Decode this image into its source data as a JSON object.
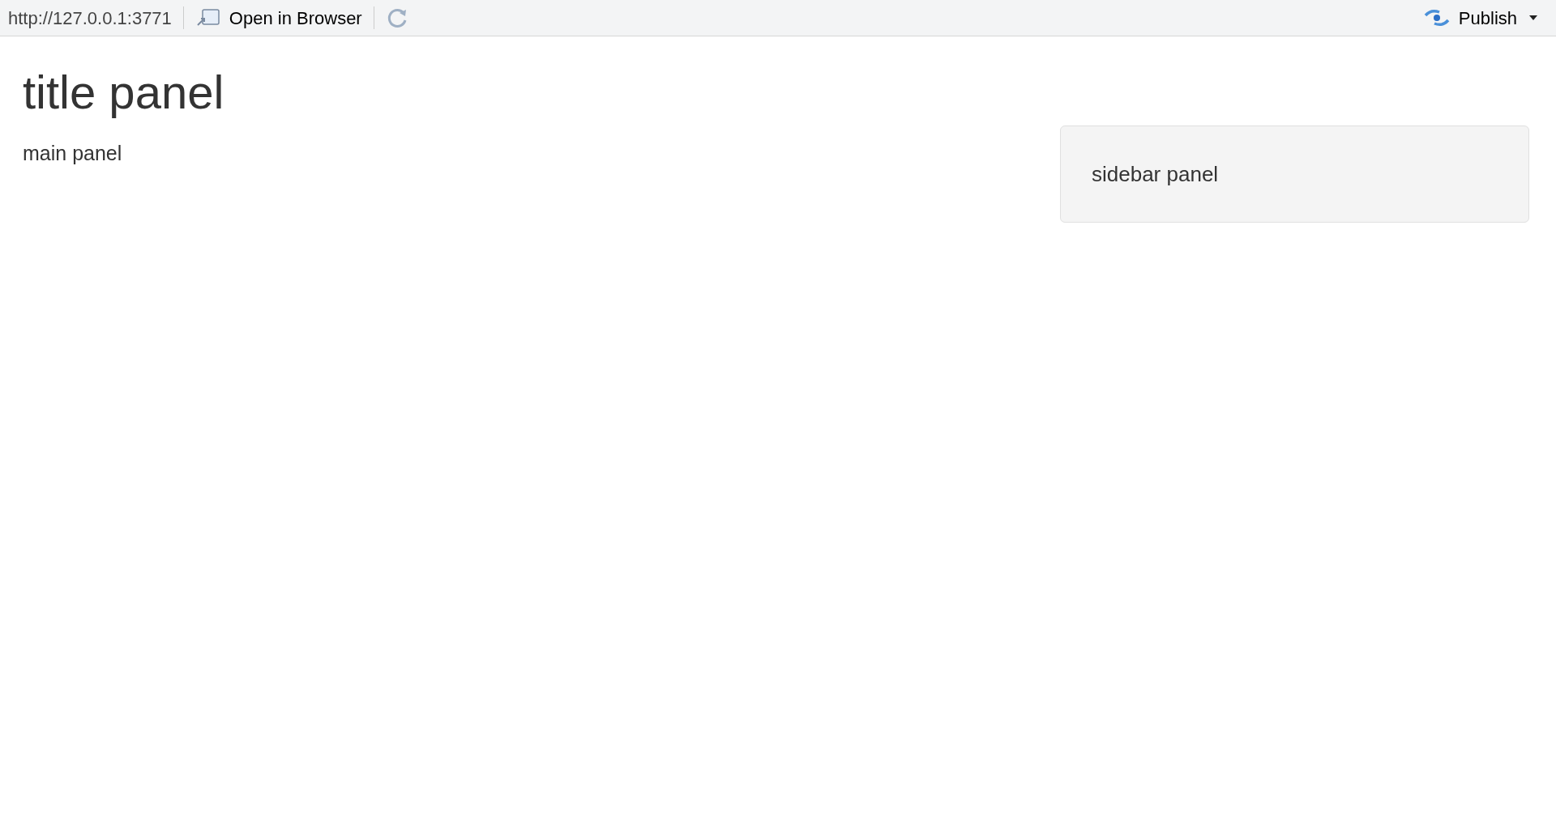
{
  "toolbar": {
    "url": "http://127.0.0.1:3771",
    "open_button": "Open in Browser",
    "publish_button": "Publish"
  },
  "title": "title panel",
  "main_panel": "main panel",
  "sidebar_panel": "sidebar panel"
}
